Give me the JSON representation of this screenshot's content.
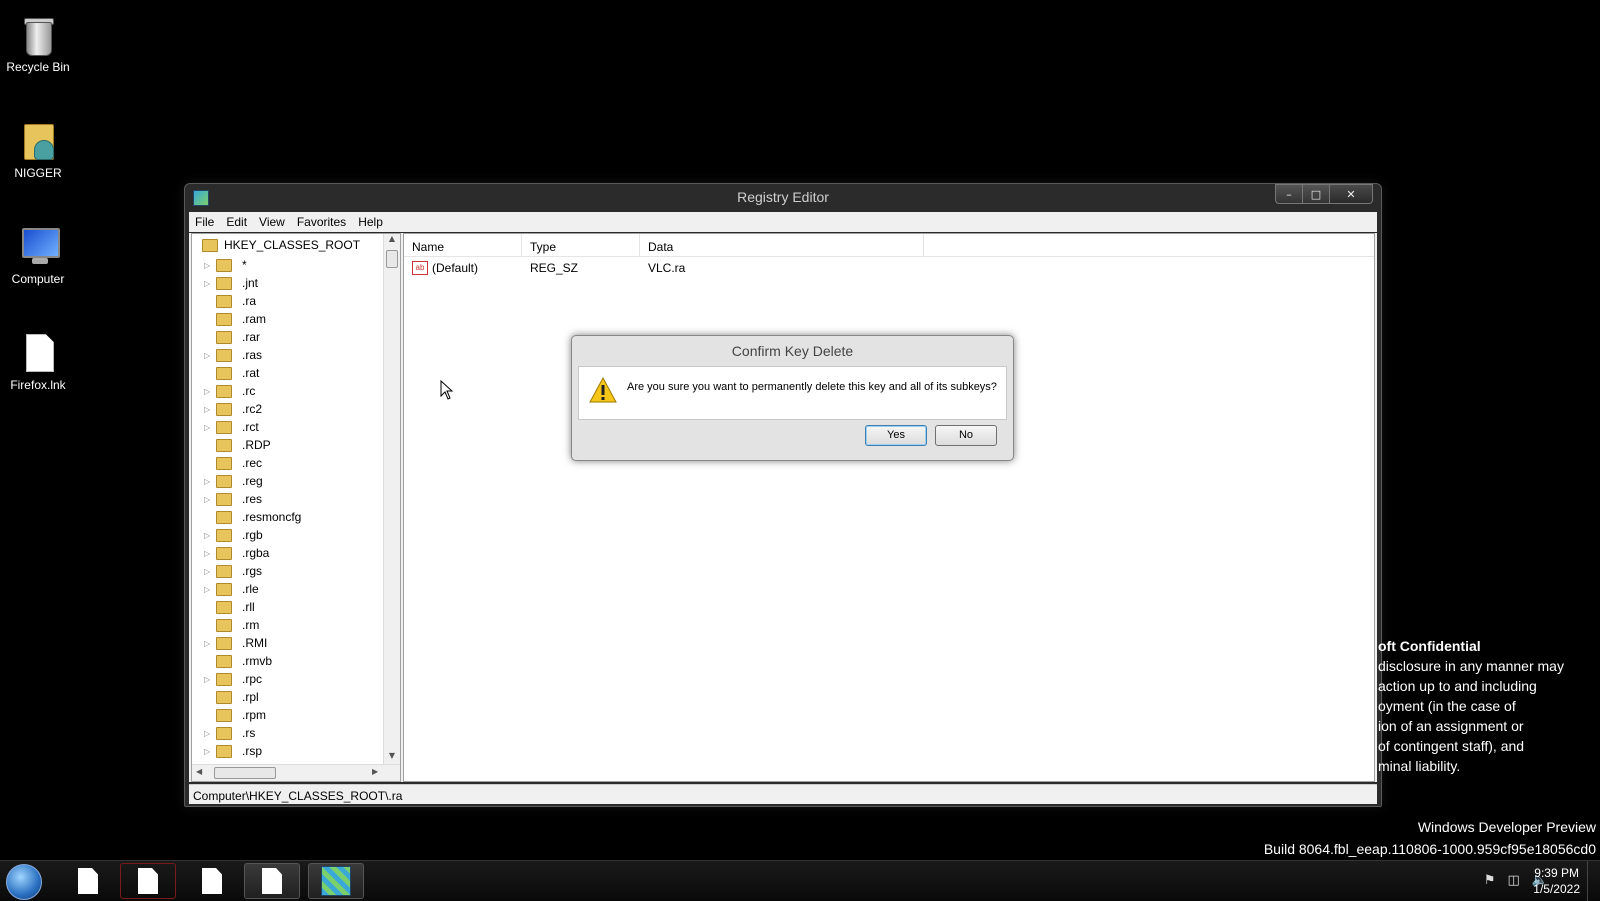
{
  "desktop": {
    "icons": [
      {
        "label": "Recycle Bin",
        "icon": "recycle-bin-icon"
      },
      {
        "label": "NIGGER",
        "icon": "user-folder-icon"
      },
      {
        "label": "Computer",
        "icon": "computer-icon"
      },
      {
        "label": "Firefox.lnk",
        "icon": "file-icon"
      }
    ]
  },
  "window": {
    "title": "Registry Editor",
    "menu": [
      "File",
      "Edit",
      "View",
      "Favorites",
      "Help"
    ],
    "tree": {
      "root": "HKEY_CLASSES_ROOT",
      "items": [
        {
          "label": "*",
          "expandable": true
        },
        {
          "label": ".jnt",
          "expandable": true
        },
        {
          "label": ".ra",
          "expandable": false
        },
        {
          "label": ".ram",
          "expandable": false
        },
        {
          "label": ".rar",
          "expandable": false
        },
        {
          "label": ".ras",
          "expandable": true
        },
        {
          "label": ".rat",
          "expandable": false
        },
        {
          "label": ".rc",
          "expandable": true
        },
        {
          "label": ".rc2",
          "expandable": true
        },
        {
          "label": ".rct",
          "expandable": true
        },
        {
          "label": ".RDP",
          "expandable": false
        },
        {
          "label": ".rec",
          "expandable": false
        },
        {
          "label": ".reg",
          "expandable": true
        },
        {
          "label": ".res",
          "expandable": true
        },
        {
          "label": ".resmoncfg",
          "expandable": false
        },
        {
          "label": ".rgb",
          "expandable": true
        },
        {
          "label": ".rgba",
          "expandable": true
        },
        {
          "label": ".rgs",
          "expandable": true
        },
        {
          "label": ".rle",
          "expandable": true
        },
        {
          "label": ".rll",
          "expandable": false
        },
        {
          "label": ".rm",
          "expandable": false
        },
        {
          "label": ".RMI",
          "expandable": true
        },
        {
          "label": ".rmvb",
          "expandable": false
        },
        {
          "label": ".rpc",
          "expandable": true
        },
        {
          "label": ".rpl",
          "expandable": false
        },
        {
          "label": ".rpm",
          "expandable": false
        },
        {
          "label": ".rs",
          "expandable": true
        },
        {
          "label": ".rsp",
          "expandable": true
        }
      ]
    },
    "values": {
      "columns": [
        "Name",
        "Type",
        "Data"
      ],
      "rows": [
        {
          "name": "(Default)",
          "type": "REG_SZ",
          "data": "VLC.ra"
        }
      ]
    },
    "status": "Computer\\HKEY_CLASSES_ROOT\\.ra"
  },
  "dialog": {
    "title": "Confirm Key Delete",
    "message": "Are you sure you want to permanently delete this key and all of its subkeys?",
    "yes": "Yes",
    "no": "No"
  },
  "watermark": {
    "lines": [
      "oft Confidential",
      "disclosure in any manner may",
      "action up to and including",
      "oyment (in the case of",
      "ion of an assignment or",
      "of contingent staff), and",
      "minal liability."
    ],
    "product": "Windows Developer Preview",
    "build": "Build 8064.fbl_eeap.110806-1000.959cf95e18056cd0"
  },
  "taskbar": {
    "time": "9:39 PM",
    "date": "1/5/2022"
  }
}
